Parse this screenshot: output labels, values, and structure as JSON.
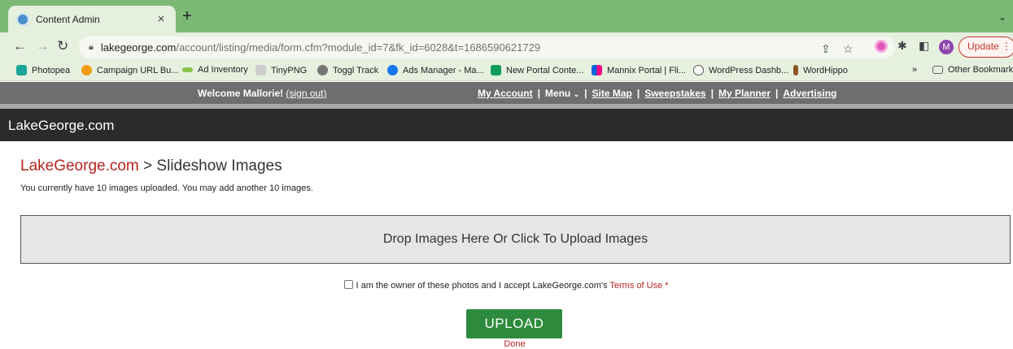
{
  "browser": {
    "tab_title": "Content Admin",
    "new_tab_symbol": "+",
    "url_host": "lakegeorge.com",
    "url_path": "/account/listing/media/form.cfm?module_id=7&fk_id=6028&t=1686590621729",
    "avatar_initial": "M",
    "update_label": "Update",
    "bookmarks": [
      {
        "label": "Photopea",
        "icon": "photopea-icon",
        "color": "#18a497"
      },
      {
        "label": "Campaign URL Bu...",
        "icon": "campaign-url-icon",
        "color": "#f39c12"
      },
      {
        "label": "Ad Inventory",
        "icon": "ad-inventory-icon",
        "color": "#8bc34a"
      },
      {
        "label": "TinyPNG",
        "icon": "tinypng-icon",
        "color": "#555555"
      },
      {
        "label": "Toggl Track",
        "icon": "toggl-icon",
        "color": "#777777"
      },
      {
        "label": "Ads Manager - Ma...",
        "icon": "meta-icon",
        "color": "#1877f2"
      },
      {
        "label": "New Portal Conte...",
        "icon": "sheets-icon",
        "color": "#0f9d58"
      },
      {
        "label": "Mannix Portal | Fli...",
        "icon": "flickr-icon",
        "color": "#e91e63"
      },
      {
        "label": "WordPress Dashb...",
        "icon": "wordpress-icon",
        "color": "#555555"
      },
      {
        "label": "WordHippo",
        "icon": "wordhippo-icon",
        "color": "#8d5524"
      }
    ],
    "overflow_symbol": "»",
    "other_bookmarks_label": "Other Bookmarks"
  },
  "topbar": {
    "welcome": "Welcome Mallorie!",
    "sign_out": "(sign out)",
    "links": {
      "my_account": "My Account",
      "menu": "Menu",
      "site_map": "Site Map",
      "sweepstakes": "Sweepstakes",
      "my_planner": "My Planner",
      "advertising": "Advertising"
    }
  },
  "header": {
    "logo": "LakeGeorge.com"
  },
  "page": {
    "breadcrumb_link": "LakeGeorge.com",
    "breadcrumb_separator": ">",
    "breadcrumb_current": "Slideshow Images",
    "info": "You currently have 10 images uploaded. You may add another 10 images.",
    "dropzone": "Drop Images Here Or Click To Upload Images",
    "terms_text": "I am the owner of these photos and I accept LakeGeorge.com's",
    "terms_link": "Terms of Use",
    "required_mark": "*",
    "upload": "UPLOAD",
    "done": "Done"
  }
}
